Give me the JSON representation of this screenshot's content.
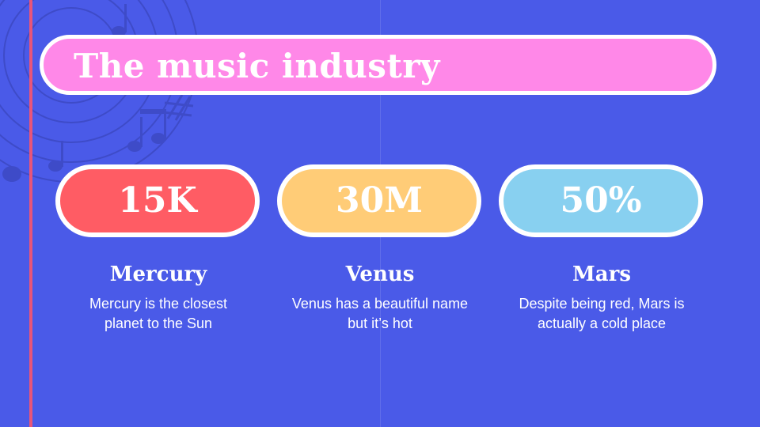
{
  "colors": {
    "background": "#4a5ae8",
    "title_pill": "#ff88e8",
    "accent_line": "#e8557a",
    "stat_1": "#ff5c64",
    "stat_2": "#ffcc77",
    "stat_3": "#88d0f0"
  },
  "header": {
    "title": "The music industry"
  },
  "stats": [
    {
      "value": "15K",
      "title": "Mercury",
      "desc": "Mercury is the closest\nplanet to the Sun"
    },
    {
      "value": "30M",
      "title": "Venus",
      "desc": "Venus has a beautiful name\nbut it’s hot"
    },
    {
      "value": "50%",
      "title": "Mars",
      "desc": "Despite being red, Mars is\nactually a cold place"
    }
  ],
  "decoration": {
    "icons": [
      "vinyl-record-icon",
      "music-note-icon"
    ]
  }
}
